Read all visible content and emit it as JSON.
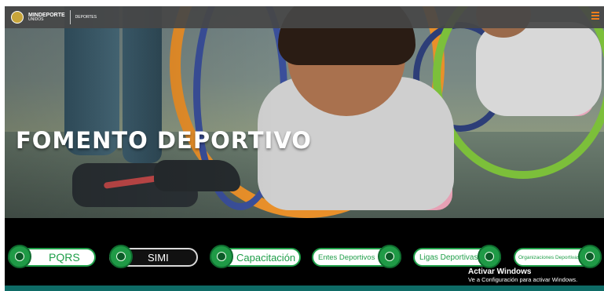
{
  "header": {
    "logo_line1": "MINDEPORTE",
    "logo_line2": "UNIDOS",
    "logo_line3": "DEPORTES",
    "menu_icon": "hamburger-menu-icon",
    "accent_color": "#f07d1c"
  },
  "hero": {
    "title": "FOMENTO DEPORTIVO"
  },
  "nav": {
    "buttons": [
      {
        "label": "PQRS",
        "icon": "globe-icon"
      },
      {
        "label": "SIMI",
        "icon": "window-icon"
      },
      {
        "label": "Capacitación",
        "icon": "chat-icon"
      },
      {
        "label": "Entes Deportivos",
        "icon": "shield-icon"
      },
      {
        "label": "Ligas Deportivas",
        "icon": "trophy-icon"
      },
      {
        "label": "Organizaciones Deportivas",
        "icon": "medal-icon"
      }
    ],
    "accent_color": "#1e9e48"
  },
  "watermark": {
    "title": "Activar Windows",
    "subtitle": "Ve a Configuración para activar Windows."
  }
}
